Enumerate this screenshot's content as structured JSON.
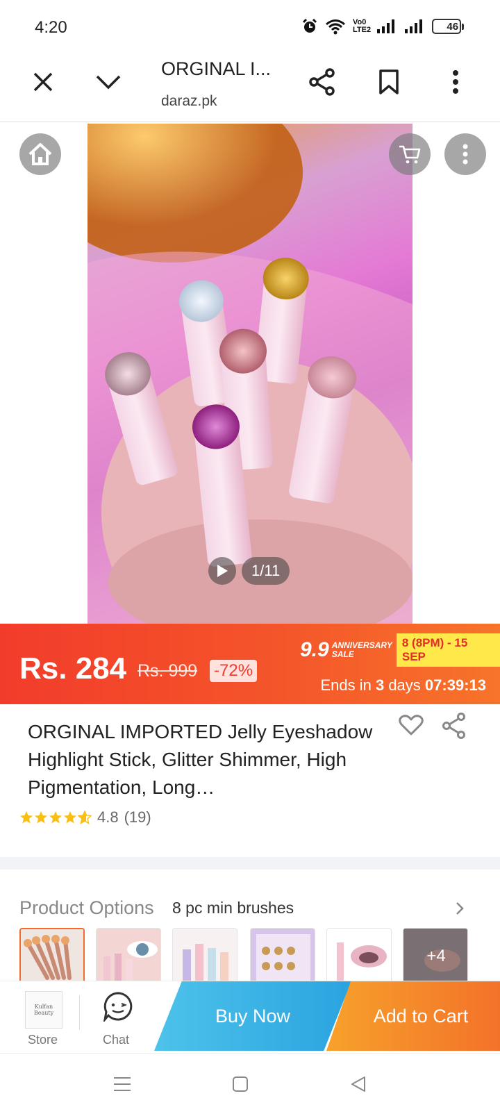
{
  "status_bar": {
    "time": "4:20",
    "network_label": "Vo0 LTE2",
    "battery": "46",
    "battery_level": 0.46
  },
  "browser": {
    "title": "ORGINAL I...",
    "url": "daraz.pk",
    "icons": [
      "close-icon",
      "chevron-down-icon",
      "share-icon",
      "bookmark-icon",
      "more-vert-icon"
    ]
  },
  "gallery": {
    "counter": "1/11",
    "icons": [
      "home-icon",
      "cart-icon",
      "more-vert-icon",
      "play-icon"
    ]
  },
  "price": {
    "current": "Rs. 284",
    "original": "Rs. 999",
    "discount": "-72%",
    "sale_number": "9.9",
    "sale_word_1": "ANNIVERSARY",
    "sale_word_2": "SALE",
    "sale_dates": "8 (8PM) - 15 SEP",
    "ends_prefix": "Ends in",
    "ends_days": "3",
    "ends_days_word": "days",
    "ends_timer": "07:39:13",
    "colors": {
      "banner_start": "#f23c2b",
      "banner_end": "#f7742a",
      "sale_tag": "#ffe84a"
    }
  },
  "product": {
    "title": "ORGINAL IMPORTED Jelly Eyeshadow Highlight Stick, Glitter Shimmer, High Pigmentation, Long…",
    "rating": "4.8",
    "reviews": "(19)",
    "stars": 4.8
  },
  "options": {
    "label": "Product Options",
    "value": "8 pc min brushes",
    "more_count": "+4"
  },
  "actions": {
    "store_label": "Store",
    "store_logo_text": "Kulfan Beauty",
    "chat_label": "Chat",
    "buy_now": "Buy Now",
    "add_to_cart": "Add to Cart",
    "colors": {
      "buy": "#2aa3e0",
      "cart": "#f3722a"
    }
  },
  "nav": {
    "icons": [
      "menu-icon",
      "home-square-icon",
      "back-icon"
    ]
  }
}
